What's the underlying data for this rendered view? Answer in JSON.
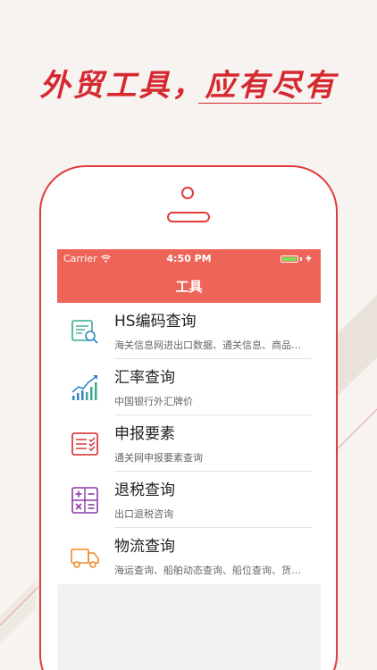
{
  "headline": "外贸工具，应有尽有",
  "status_bar": {
    "carrier": "Carrier",
    "time": "4:50 PM",
    "battery_level": 1.0
  },
  "nav": {
    "title": "工具"
  },
  "tools": [
    {
      "label": "HS编码查询",
      "desc": "海关信息网进出口数据、通关信息、商品…",
      "icon": "hs-code-search-icon",
      "color": "#3aa88f"
    },
    {
      "label": "汇率查询",
      "desc": "中国银行外汇牌价",
      "icon": "exchange-rate-chart-icon",
      "color": "#2f86c7"
    },
    {
      "label": "申报要素",
      "desc": "通关网申报要素查询",
      "icon": "declaration-checklist-icon",
      "color": "#d6282f"
    },
    {
      "label": "退税查询",
      "desc": "出口退税咨询",
      "icon": "calculator-icon",
      "color": "#8a3aa6"
    },
    {
      "label": "物流查询",
      "desc": "海运查询、船舶动态查询、船位查询、货…",
      "icon": "delivery-truck-icon",
      "color": "#ef8a2a"
    }
  ],
  "colors": {
    "brand_red": "#d6282f",
    "appbar": "#ef6458"
  }
}
